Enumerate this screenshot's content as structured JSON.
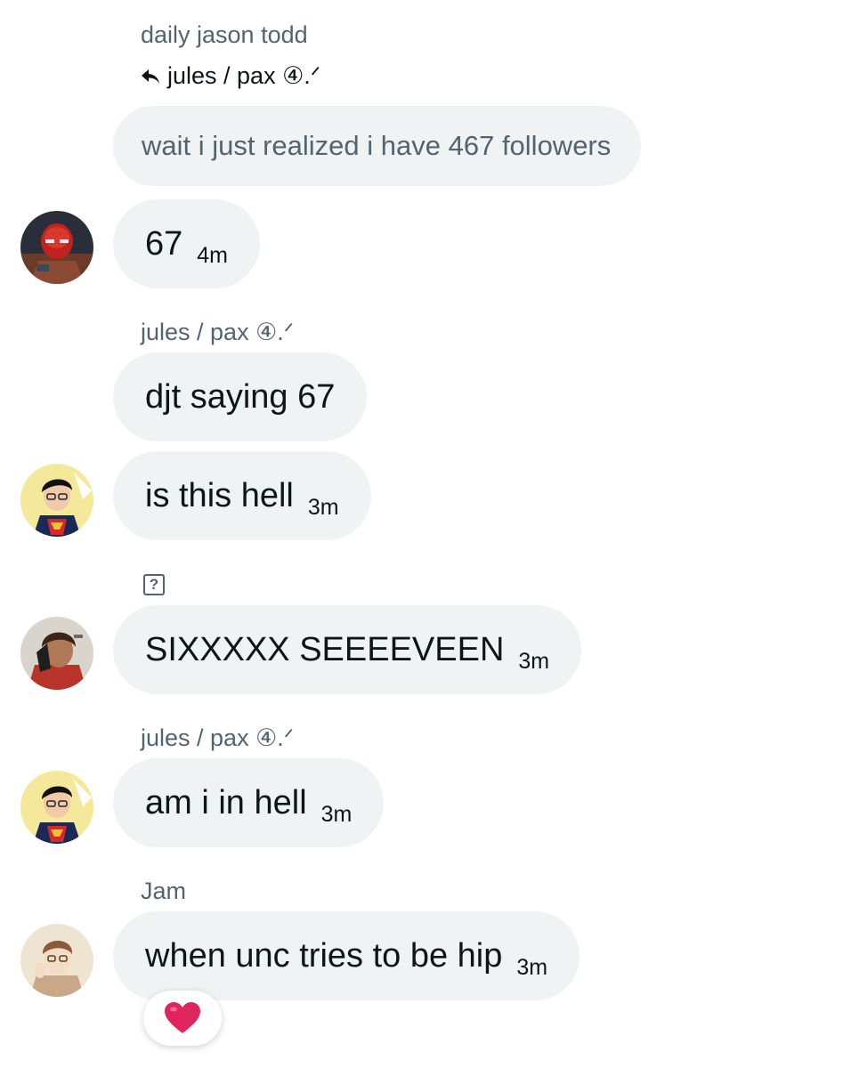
{
  "thread": {
    "first_sender": "daily jason todd",
    "reply_to": {
      "icon": "reply-arrow-icon",
      "name": "jules / pax ④.ᐟ",
      "quoted_text": "wait i just realized i have 467 followers"
    },
    "messages": [
      {
        "text": "67",
        "time": "4m",
        "avatar": "red-hood-avatar"
      },
      {
        "sender": "jules / pax ④.ᐟ",
        "text": "djt saying 67",
        "time": ""
      },
      {
        "text": "is this hell",
        "time": "3m",
        "avatar": "superboy-avatar"
      },
      {
        "sender_icon": "unknown-glyph-icon",
        "sender": "?",
        "text": "SIXXXXX SEEEEVEEN",
        "time": "3m",
        "avatar": "hooded-character-avatar"
      },
      {
        "sender": "jules / pax ④.ᐟ",
        "text": "am i in hell",
        "time": "3m",
        "avatar": "superboy-avatar"
      },
      {
        "sender": "Jam",
        "text": "when unc tries to be hip",
        "time": "3m",
        "avatar": "sketch-character-avatar",
        "reaction": "❤️"
      }
    ]
  },
  "colors": {
    "bubble_bg": "#eff3f4",
    "secondary_text": "#536471",
    "primary_text": "#0f1419",
    "heart": "#e0245e"
  }
}
